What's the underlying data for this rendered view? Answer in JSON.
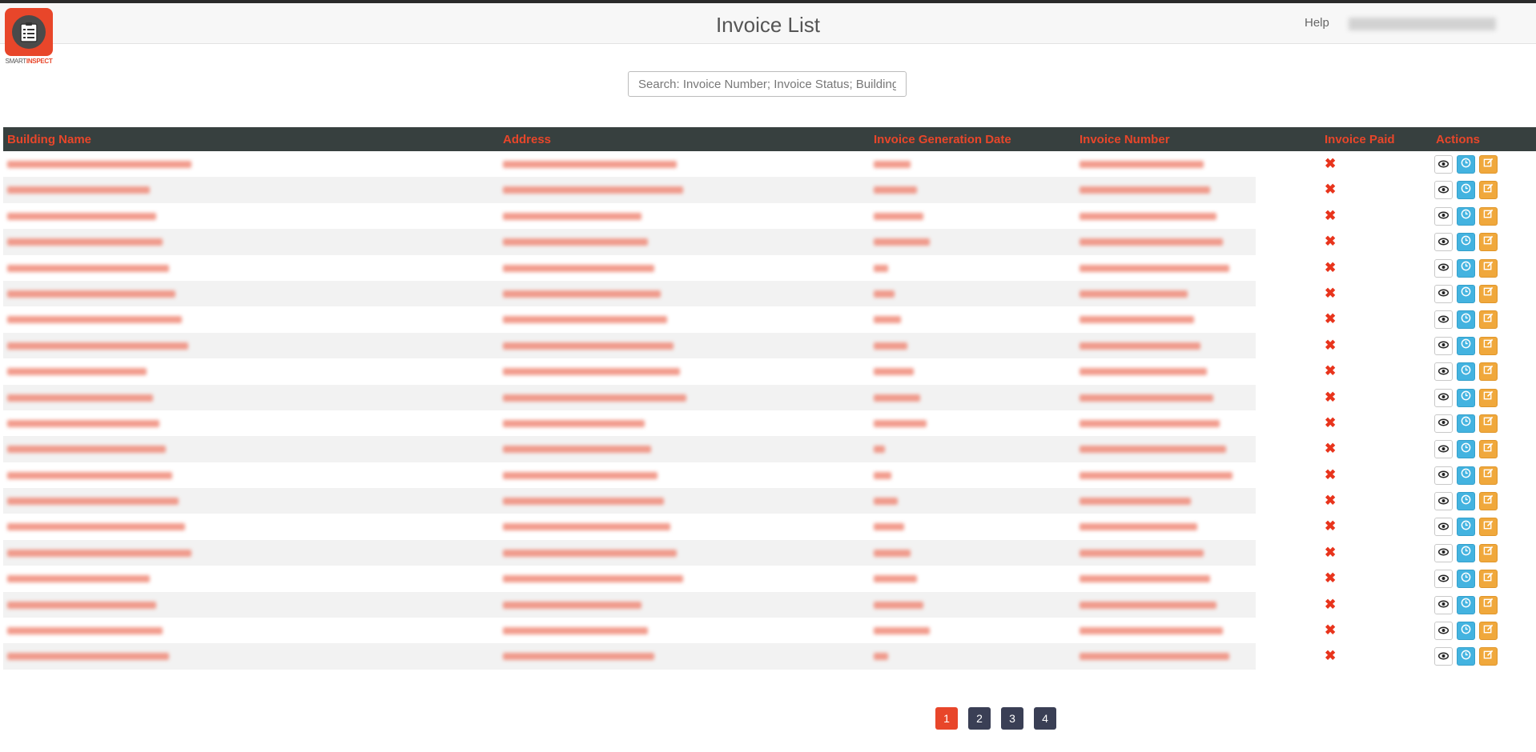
{
  "header": {
    "title": "Invoice List",
    "help_label": "Help",
    "logo_text_part1": "SMART",
    "logo_text_part2": "INSPECT"
  },
  "search": {
    "placeholder": "Search: Invoice Number; Invoice Status; Building Na"
  },
  "table": {
    "headers": {
      "building_name": "Building Name",
      "address": "Address",
      "generation_date": "Invoice Generation Date",
      "invoice_number": "Invoice Number",
      "invoice_paid": "Invoice Paid",
      "actions": "Actions"
    },
    "rows": [
      {
        "building": "",
        "address": "",
        "date": "",
        "number": "",
        "paid": "✖"
      },
      {
        "building": "",
        "address": "",
        "date": "",
        "number": "",
        "paid": "✖"
      },
      {
        "building": "",
        "address": "",
        "date": "",
        "number": "",
        "paid": "✖"
      },
      {
        "building": "",
        "address": "",
        "date": "",
        "number": "",
        "paid": "✖"
      },
      {
        "building": "",
        "address": "",
        "date": "",
        "number": "",
        "paid": "✖"
      },
      {
        "building": "",
        "address": "",
        "date": "",
        "number": "",
        "paid": "✖"
      },
      {
        "building": "",
        "address": "",
        "date": "",
        "number": "",
        "paid": "✖"
      },
      {
        "building": "",
        "address": "",
        "date": "",
        "number": "",
        "paid": "✖"
      },
      {
        "building": "",
        "address": "",
        "date": "",
        "number": "",
        "paid": "✖"
      },
      {
        "building": "",
        "address": "",
        "date": "",
        "number": "",
        "paid": "✖"
      },
      {
        "building": "",
        "address": "",
        "date": "",
        "number": "",
        "paid": "✖"
      },
      {
        "building": "",
        "address": "",
        "date": "",
        "number": "",
        "paid": "✖"
      },
      {
        "building": "",
        "address": "",
        "date": "",
        "number": "",
        "paid": "✖"
      },
      {
        "building": "",
        "address": "",
        "date": "",
        "number": "",
        "paid": "✖"
      },
      {
        "building": "",
        "address": "",
        "date": "",
        "number": "",
        "paid": "✖"
      },
      {
        "building": "",
        "address": "",
        "date": "",
        "number": "",
        "paid": "✖"
      },
      {
        "building": "",
        "address": "",
        "date": "",
        "number": "",
        "paid": "✖"
      },
      {
        "building": "",
        "address": "",
        "date": "",
        "number": "",
        "paid": "✖"
      },
      {
        "building": "",
        "address": "",
        "date": "",
        "number": "",
        "paid": "✖"
      },
      {
        "building": "",
        "address": "",
        "date": "",
        "number": "",
        "paid": "✖"
      }
    ]
  },
  "pagination": {
    "pages": [
      "1",
      "2",
      "3",
      "4"
    ],
    "active_page": "1"
  },
  "icons": {
    "view": "eye-icon",
    "history": "clock-icon",
    "edit": "edit-icon",
    "not_paid": "cross-icon"
  },
  "colors": {
    "accent": "#e8462a",
    "header_bg": "#37403f",
    "history_button": "#43b3e0",
    "edit_button": "#f0a83c",
    "pager_bg": "#3a3f55"
  }
}
